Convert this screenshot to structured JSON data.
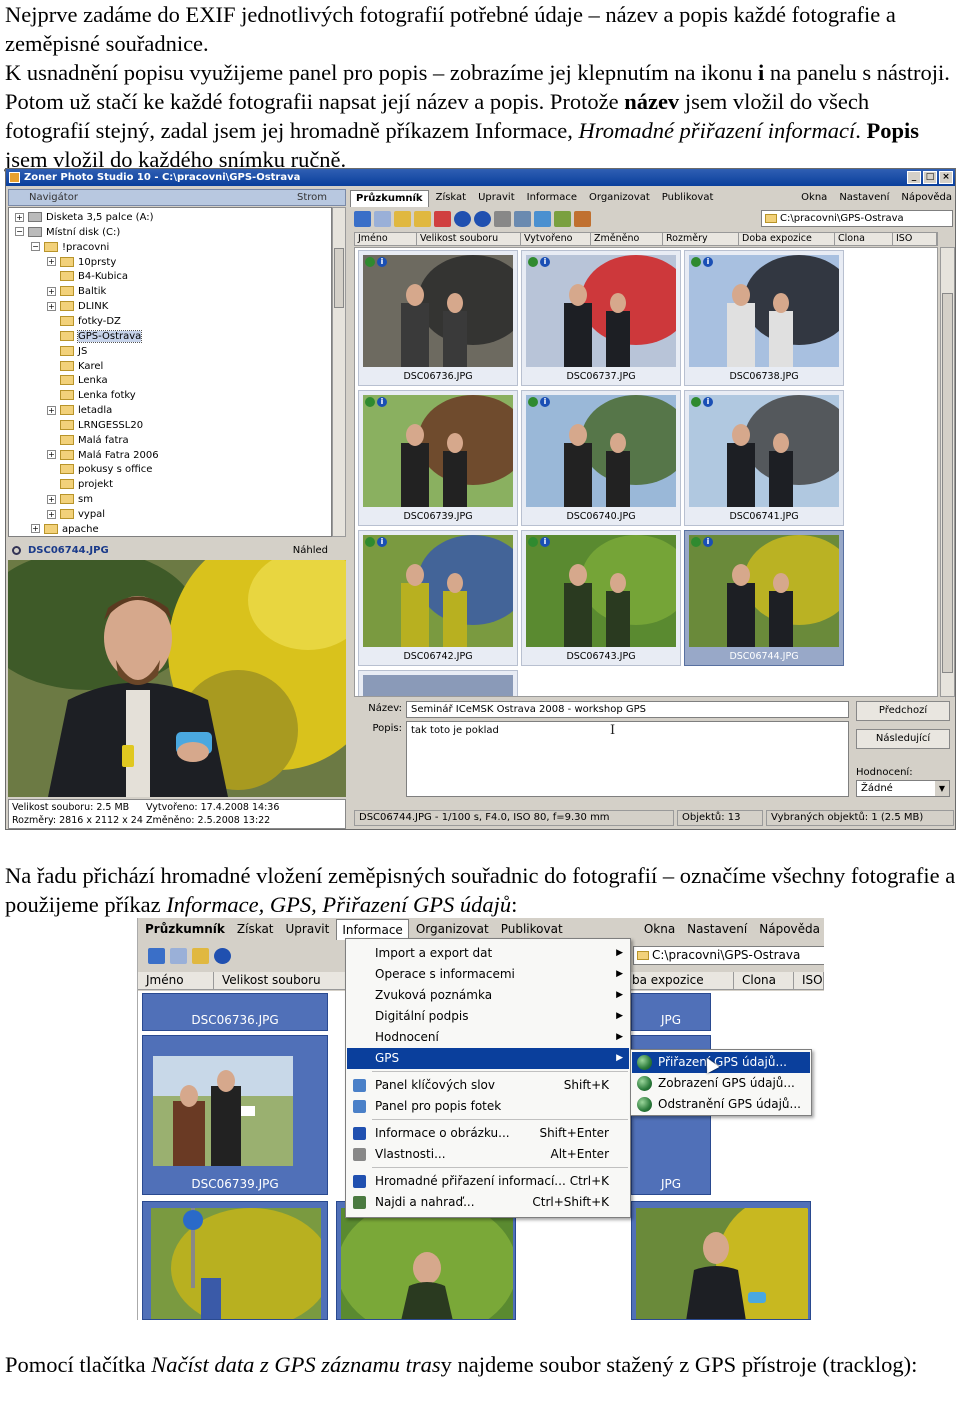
{
  "intro": {
    "line1": "Nejprve zadáme do EXIF jednotlivých fotografií potřebné údaje – název a popis každé fotografie a zeměpisné souřadnice.",
    "p2_a": "K usnadnění popisu využijeme panel pro popis – zobrazíme jej klepnutím na ikonu ",
    "p2_i": "i",
    "p2_b": " na panelu s nástroji. Potom už stačí ke každé fotografii napsat její název a popis. Protože ",
    "p2_nazev": "název",
    "p2_c": " jsem vložil do všech fotografií stejný, zadal jsem jej hromadně příkazem Informace, ",
    "p2_cmd": "Hromadné přiřazení informací",
    "p2_d": ". ",
    "p2_popis": "Popis",
    "p2_e": " jsem vložil do každého snímku ručně."
  },
  "screenshot1": {
    "title": "Zoner Photo Studio 10 - C:\\pracovni\\GPS-Ostrava",
    "window_buttons": [
      "_",
      "□",
      "×"
    ],
    "navigator": {
      "title": "Navigátor",
      "right": "Strom"
    },
    "tree": [
      {
        "label": "Disketa 3,5 palce (A:)",
        "level": 1,
        "exp": "+",
        "icon": "drive"
      },
      {
        "label": "Místní disk (C:)",
        "level": 1,
        "exp": "−",
        "icon": "drive"
      },
      {
        "label": "!pracovni",
        "level": 2,
        "exp": "−",
        "icon": "folder"
      },
      {
        "label": "10prsty",
        "level": 3,
        "exp": "+",
        "icon": "folder"
      },
      {
        "label": "B4-Kubica",
        "level": 3,
        "exp": "",
        "icon": "folder"
      },
      {
        "label": "Baltik",
        "level": 3,
        "exp": "+",
        "icon": "folder"
      },
      {
        "label": "DLINK",
        "level": 3,
        "exp": "+",
        "icon": "folder"
      },
      {
        "label": "fotky-DZ",
        "level": 3,
        "exp": "",
        "icon": "folder"
      },
      {
        "label": "GPS-Ostrava",
        "level": 3,
        "exp": "",
        "icon": "folder",
        "selected": true
      },
      {
        "label": "JS",
        "level": 3,
        "exp": "",
        "icon": "folder"
      },
      {
        "label": "Karel",
        "level": 3,
        "exp": "",
        "icon": "folder"
      },
      {
        "label": "Lenka",
        "level": 3,
        "exp": "",
        "icon": "folder"
      },
      {
        "label": "Lenka fotky",
        "level": 3,
        "exp": "",
        "icon": "folder"
      },
      {
        "label": "letadla",
        "level": 3,
        "exp": "+",
        "icon": "folder"
      },
      {
        "label": "LRNGESSL20",
        "level": 3,
        "exp": "",
        "icon": "folder"
      },
      {
        "label": "Malá fatra",
        "level": 3,
        "exp": "",
        "icon": "folder"
      },
      {
        "label": "Malá Fatra 2006",
        "level": 3,
        "exp": "+",
        "icon": "folder"
      },
      {
        "label": "pokusy s office",
        "level": 3,
        "exp": "",
        "icon": "folder"
      },
      {
        "label": "projekt",
        "level": 3,
        "exp": "",
        "icon": "folder"
      },
      {
        "label": "sm",
        "level": 3,
        "exp": "+",
        "icon": "folder"
      },
      {
        "label": "vypal",
        "level": 3,
        "exp": "+",
        "icon": "folder"
      },
      {
        "label": "apache",
        "level": 2,
        "exp": "+",
        "icon": "folder"
      }
    ],
    "preview": {
      "file": "DSC06744.JPG",
      "right": "Náhled"
    },
    "info": {
      "size": "Velikost souboru: 2.5 MB",
      "created": "Vytvořeno: 17.4.2008 14:36",
      "dims": "Rozměry: 2816 x 2112 x 24",
      "changed": "Změněno: 2.5.2008 13:22"
    },
    "menus": [
      "Průzkumník",
      "Získat",
      "Upravit",
      "Informace",
      "Organizovat",
      "Publikovat",
      "Okna",
      "Nastavení",
      "Nápověda"
    ],
    "path": "C:\\pracovni\\GPS-Ostrava",
    "columns": [
      "Jméno",
      "Velikost souboru",
      "Vytvořeno",
      "Změněno",
      "Rozměry",
      "Doba expozice",
      "Clona",
      "ISO"
    ],
    "thumbnails": [
      {
        "file": "DSC06736.JPG"
      },
      {
        "file": "DSC06737.JPG"
      },
      {
        "file": "DSC06738.JPG"
      },
      {
        "file": "DSC06739.JPG"
      },
      {
        "file": "DSC06740.JPG"
      },
      {
        "file": "DSC06741.JPG"
      },
      {
        "file": "DSC06742.JPG"
      },
      {
        "file": "DSC06743.JPG"
      },
      {
        "file": "DSC06744.JPG",
        "selected": true
      }
    ],
    "desc_panel": {
      "name_label": "Název:",
      "name_value": "Seminář ICeMSK Ostrava 2008 - workshop GPS",
      "popis_label": "Popis:",
      "popis_value": "tak toto je poklad",
      "prev": "Předchozí",
      "next": "Následující",
      "rating_label": "Hodnocení:",
      "rating_value": "Žádné"
    },
    "status": {
      "exif": "DSC06744.JPG - 1/100 s, F4.0, ISO 80, f=9.30 mm",
      "objects": "Objektů: 13",
      "selected": "Vybraných objektů: 1 (2.5 MB)"
    }
  },
  "para2": {
    "a": "Na řadu přichází hromadné vložení zeměpisných souřadnic do fotografií – označíme všechny fotografie a použijeme příkaz ",
    "cmd": "Informace, GPS, Přiřazení GPS údajů",
    "b": ":"
  },
  "screenshot2": {
    "menus": [
      "Průzkumník",
      "Získat",
      "Upravit",
      "Informace",
      "Organizovat",
      "Publikovat",
      "Okna",
      "Nastavení",
      "Nápověda"
    ],
    "path": "C:\\pracovni\\GPS-Ostrava",
    "columns": [
      "Jméno",
      "Velikost souboru",
      "ba expozice",
      "Clona",
      "ISO"
    ],
    "thumb_captions": [
      "DSC06736.JPG",
      "JPG",
      "DSC06739.JPG",
      "JPG"
    ],
    "menu_items": [
      {
        "label": "Import a export dat",
        "sub": true
      },
      {
        "label": "Operace s informacemi",
        "sub": true
      },
      {
        "label": "Zvuková poznámka",
        "sub": true
      },
      {
        "label": "Digitální podpis",
        "sub": true
      },
      {
        "label": "Hodnocení",
        "sub": true
      },
      {
        "label": "GPS",
        "sub": true,
        "highlight": true
      },
      {
        "label": "Panel klíčových slov",
        "shortcut": "Shift+K"
      },
      {
        "label": "Panel pro popis fotek"
      },
      {
        "label": "Informace o obrázku...",
        "shortcut": "Shift+Enter"
      },
      {
        "label": "Vlastnosti...",
        "shortcut": "Alt+Enter"
      },
      {
        "label": "Hromadné přiřazení informací...",
        "shortcut": "Ctrl+K"
      },
      {
        "label": "Najdi a nahraď...",
        "shortcut": "Ctrl+Shift+K"
      }
    ],
    "submenu": [
      "Přiřazení GPS údajů...",
      "Zobrazení GPS údajů...",
      "Odstranění GPS údajů..."
    ]
  },
  "para3": {
    "a": "Pomocí tlačítka ",
    "cmd": "Načíst data z GPS záznamu tras",
    "b": "y najdeme soubor stažený z GPS přístroje (tracklog):"
  }
}
